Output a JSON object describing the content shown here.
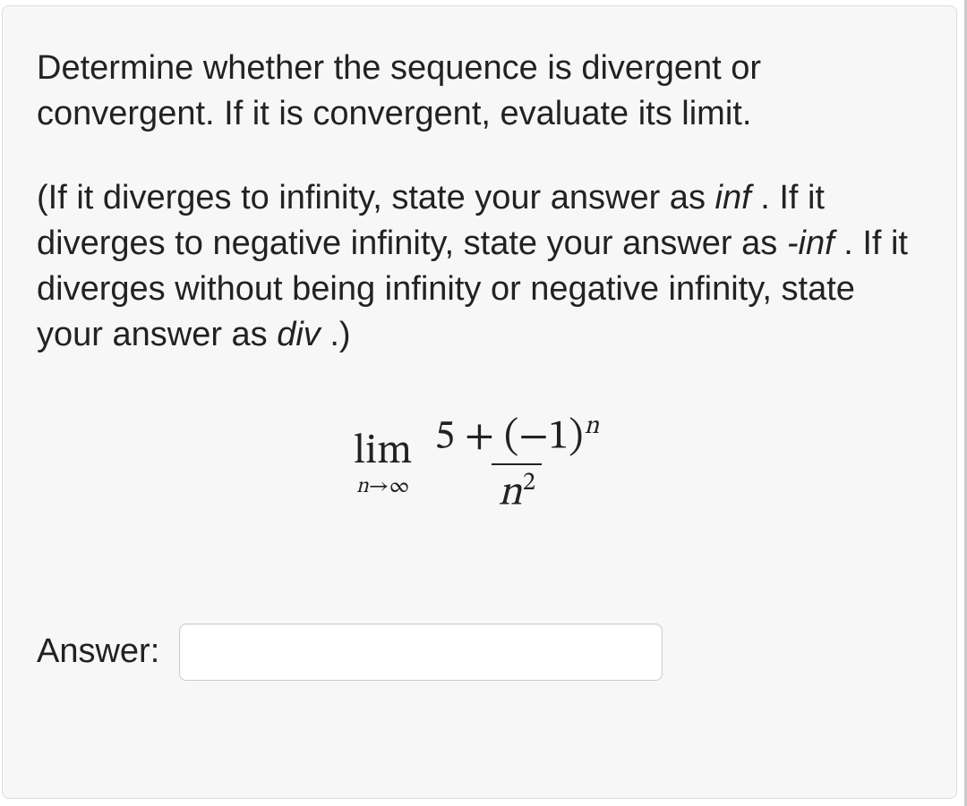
{
  "question": {
    "prompt": "Determine whether the sequence is divergent or convergent. If it is convergent, evaluate its limit.",
    "instructions_pre": "(If it diverges to infinity, state your answer as ",
    "kw_inf": "inf",
    "instructions_mid1": " . If it diverges to negative infinity, state your answer as ",
    "kw_ninf": "-inf",
    "instructions_mid2": " . If it diverges without being infinity or negative infinity, state your answer as ",
    "kw_div": "div",
    "instructions_end": " .)"
  },
  "math": {
    "lim": "lim",
    "sub_n": "n",
    "sub_arrow": "→",
    "sub_inf": "∞",
    "num_left": "5 + (",
    "num_neg1": "−1)",
    "num_exp": "n",
    "den_var": "n",
    "den_exp": "2"
  },
  "answer": {
    "label": "Answer:",
    "value": ""
  }
}
